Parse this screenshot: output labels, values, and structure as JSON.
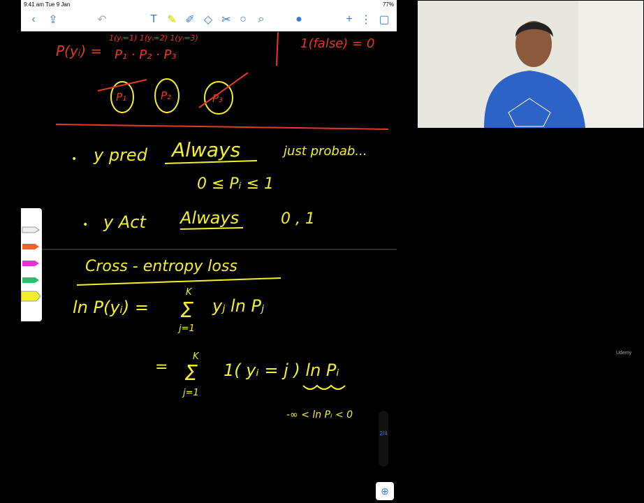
{
  "status_bar": {
    "time": "9:41 am  Tue 9 Jan",
    "battery": "77%"
  },
  "toolbar": {
    "icons": [
      "back-icon",
      "share-icon",
      "undo-icon",
      "text-icon",
      "highlighter-icon",
      "pen-icon",
      "eraser-icon",
      "lasso-icon",
      "shapes-icon",
      "search-icon",
      "mic-icon",
      "add-icon",
      "more-icon",
      "page-icon"
    ]
  },
  "notes": {
    "line1_lhs": "P(yᵢ) =",
    "line1_rhs": "1(yᵢ=1)  1(yᵢ=2)  1(yᵢ=3)",
    "line1_powers": "P₁  ·  P₂  ·  P₃",
    "indicator_false": "1(false) = 0",
    "circled": [
      "P₁",
      "P₂",
      "P₃"
    ],
    "bullet1_label": "y pred",
    "bullet1_always": "Always",
    "bullet1_tail": "just probab...",
    "bullet1_range": "0 ≤ Pᵢ ≤ 1",
    "bullet2_label": "y Act",
    "bullet2_always": "Always",
    "bullet2_values": "0 , 1",
    "section_title": "Cross - entropy  loss",
    "eq1_lhs": "ln P(yᵢ) =",
    "eq1_sum_top": "K",
    "eq1_sum_bottom": "j=1",
    "eq1_term": "yⱼ ln Pⱼ",
    "eq2_eq": "=",
    "eq2_sum_top": "K",
    "eq2_sum_bottom": "j=1",
    "eq2_term": "1( yᵢ = j ) ln Pᵢ",
    "eq3_range": "-∞ < ln Pᵢ < 0"
  },
  "zoom_symbol": "⊕",
  "scroll_label": "2/4",
  "watermark": "Udemy",
  "colors": {
    "yellow": "#f3ef2a",
    "red": "#e23a25",
    "toolbar_blue": "#3a7bd5"
  }
}
